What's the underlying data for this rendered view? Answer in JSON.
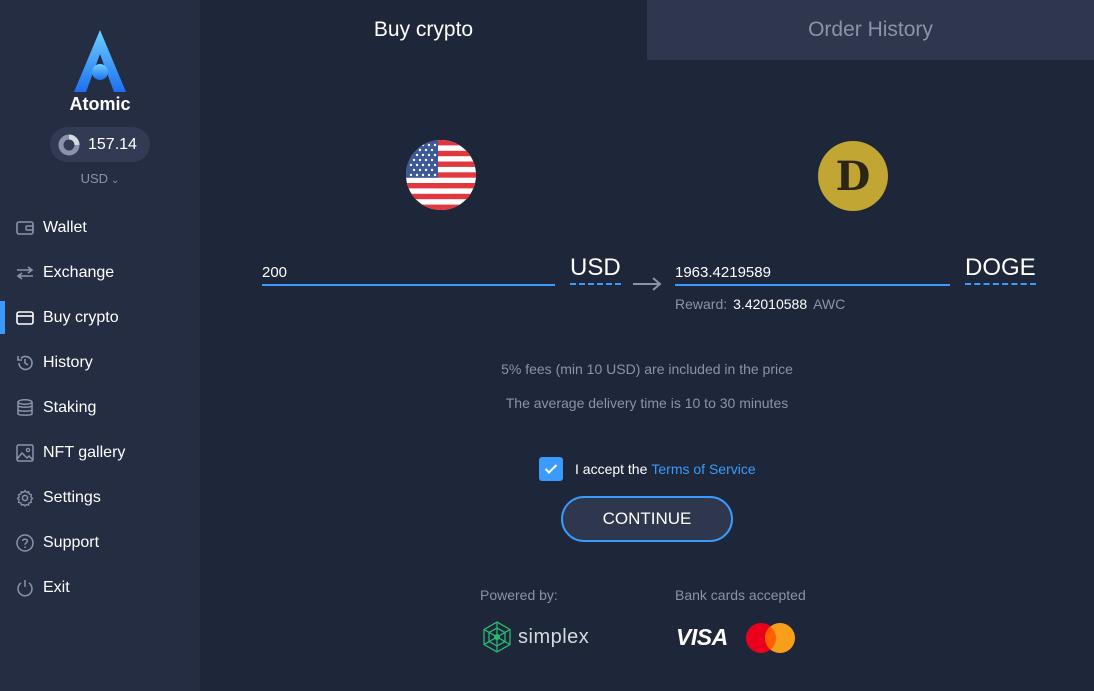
{
  "brand": {
    "name": "Atomic"
  },
  "balance": {
    "amount": "157.14",
    "currency": "USD"
  },
  "nav": [
    {
      "id": "wallet",
      "label": "Wallet",
      "icon": "wallet-icon"
    },
    {
      "id": "exchange",
      "label": "Exchange",
      "icon": "exchange-icon"
    },
    {
      "id": "buy-crypto",
      "label": "Buy crypto",
      "icon": "card-icon",
      "active": true
    },
    {
      "id": "history",
      "label": "History",
      "icon": "history-icon"
    },
    {
      "id": "staking",
      "label": "Staking",
      "icon": "coins-stack-icon"
    },
    {
      "id": "nft-gallery",
      "label": "NFT gallery",
      "icon": "image-icon"
    },
    {
      "id": "settings",
      "label": "Settings",
      "icon": "gear-icon"
    },
    {
      "id": "support",
      "label": "Support",
      "icon": "help-icon"
    },
    {
      "id": "exit",
      "label": "Exit",
      "icon": "power-icon"
    }
  ],
  "tabs": {
    "buy": "Buy crypto",
    "history": "Order History"
  },
  "exchange": {
    "from_value": "200",
    "from_currency": "USD",
    "to_value": "1963.4219589",
    "to_currency": "DOGE",
    "reward_label": "Reward:",
    "reward_value": "3.42010588",
    "reward_unit": "AWC"
  },
  "info": {
    "fees": "5% fees (min 10 USD) are included in the price",
    "delivery": "The average delivery time is 10 to 30 minutes"
  },
  "terms": {
    "prefix": "I accept the",
    "link": "Terms of Service",
    "checked": true
  },
  "continue_label": "CONTINUE",
  "footer": {
    "powered_by": "Powered by:",
    "provider": "simplex",
    "cards_label": "Bank cards accepted",
    "visa": "VISA"
  },
  "colors": {
    "accent": "#3a9bfc",
    "bg": "#1e2639",
    "sidebar": "#252d42",
    "doge": "#c2a633"
  }
}
